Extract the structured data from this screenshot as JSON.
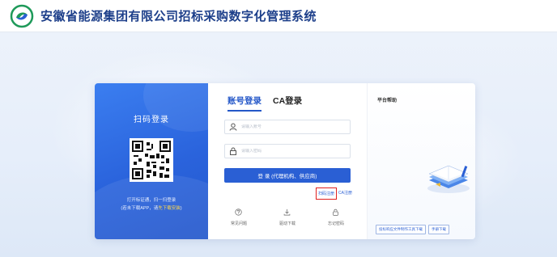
{
  "header": {
    "title": "安徽省能源集团有限公司招标采购数字化管理系统",
    "logo_icon": "energy-swirl-logo"
  },
  "qr_panel": {
    "title": "扫码登录",
    "hint_line1": "打开标证通，扫一扫登录",
    "hint_line2_prefix": "(若未下载APP，请",
    "hint_line2_link": "先下载安装",
    "hint_line2_suffix": ")"
  },
  "login": {
    "tabs": [
      {
        "label": "账号登录",
        "active": true
      },
      {
        "label": "CA登录",
        "active": false
      }
    ],
    "username_placeholder": "请输入账号",
    "password_placeholder": "请输入密码",
    "login_button": "登 录 (代理机构、供应商)",
    "register_scan": "扫码注册",
    "register_ca": "CA注册",
    "bottom_links": [
      {
        "label": "常见问题",
        "icon": "question-circle-icon"
      },
      {
        "label": "驱动下载",
        "icon": "download-icon"
      },
      {
        "label": "忘记密码",
        "icon": "lock-icon"
      }
    ],
    "accent": "#2a5fd4"
  },
  "help": {
    "title": "平台帮助",
    "buttons": [
      "投标响应文件制作工具下载",
      "手册下载"
    ]
  }
}
